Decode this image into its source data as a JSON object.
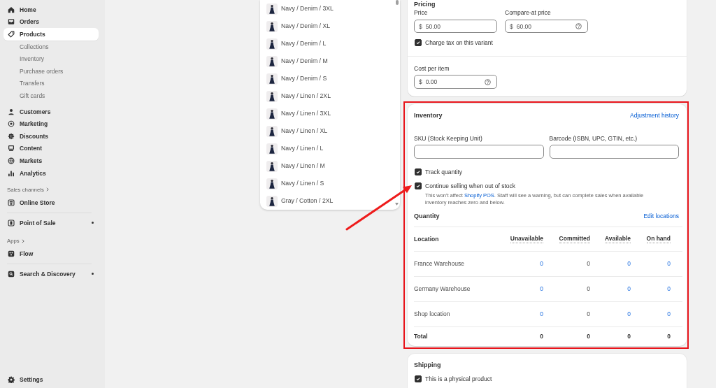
{
  "sidebar": {
    "nav": [
      {
        "items": [
          {
            "label": "Home",
            "selected": false
          },
          {
            "label": "Orders",
            "selected": false
          },
          {
            "label": "Products",
            "selected": true,
            "children": [
              {
                "label": "Collections",
                "selected": false
              },
              {
                "label": "Inventory",
                "selected": false
              },
              {
                "label": "Purchase orders",
                "selected": false
              },
              {
                "label": "Transfers",
                "selected": false
              },
              {
                "label": "Gift cards",
                "selected": false
              }
            ]
          }
        ]
      },
      {
        "items": [
          {
            "label": "Customers",
            "selected": false
          },
          {
            "label": "Marketing",
            "selected": false
          },
          {
            "label": "Discounts",
            "selected": false
          },
          {
            "label": "Content",
            "selected": false
          },
          {
            "label": "Markets",
            "selected": false
          },
          {
            "label": "Analytics",
            "selected": false
          }
        ]
      }
    ],
    "sections": [
      {
        "heading": "Sales channels",
        "items": [
          {
            "label": "Online Store",
            "selected": false,
            "dot": false
          },
          {
            "label": "Point of Sale",
            "selected": false,
            "dot": true
          }
        ]
      },
      {
        "heading": "Apps",
        "items": [
          {
            "label": "Flow",
            "selected": false,
            "dot": false
          },
          {
            "label": "Search & Discovery",
            "selected": false,
            "dot": true
          }
        ]
      }
    ],
    "settings": {
      "label": "Settings"
    }
  },
  "variants": {
    "items": [
      {
        "label": "Navy / Denim / 3XL",
        "selected": false
      },
      {
        "label": "Navy / Denim / XL",
        "selected": false
      },
      {
        "label": "Navy / Denim / L",
        "selected": false
      },
      {
        "label": "Navy / Denim / M",
        "selected": false
      },
      {
        "label": "Navy / Denim / S",
        "selected": false
      },
      {
        "label": "Navy / Linen / 2XL",
        "selected": false
      },
      {
        "label": "Navy / Linen / 3XL",
        "selected": false
      },
      {
        "label": "Navy / Linen / XL",
        "selected": false
      },
      {
        "label": "Navy / Linen / L",
        "selected": false
      },
      {
        "label": "Navy / Linen / M",
        "selected": false
      },
      {
        "label": "Navy / Linen / S",
        "selected": false
      },
      {
        "label": "Gray / Cotton / 2XL",
        "selected": false
      }
    ]
  },
  "pricing": {
    "title": "Pricing",
    "fields": [
      {
        "label": "Price",
        "prefix": "$",
        "value": "50.00",
        "help": false
      },
      {
        "label": "Compare-at price",
        "prefix": "$",
        "value": "60.00",
        "help": true
      }
    ],
    "charge_tax": {
      "label": "Charge tax on this variant",
      "checked": true
    },
    "cost": {
      "label": "Cost per item",
      "prefix": "$",
      "value": "0.00",
      "help": true
    }
  },
  "inventory": {
    "title": "Inventory",
    "link": "Adjustment history",
    "fields": [
      {
        "label": "SKU (Stock Keeping Unit)"
      },
      {
        "label": "Barcode (ISBN, UPC, GTIN, etc.)"
      }
    ],
    "options": [
      {
        "label": "Track quantity",
        "checked": true
      },
      {
        "label": "Continue selling when out of stock",
        "checked": true,
        "note": {
          "before": "This won't affect ",
          "link": "Shopify POS",
          "after": ". Staff will see a warning, but can complete sales when available inventory reaches zero and below."
        }
      }
    ],
    "quantity": {
      "title": "Quantity",
      "link": "Edit locations",
      "columns": [
        "Location",
        "Unavailable",
        "Committed",
        "Available",
        "On hand"
      ],
      "rows": [
        {
          "cells": [
            {
              "text": "France Warehouse",
              "link": false
            },
            {
              "text": "0",
              "link": true
            },
            {
              "text": "0",
              "link": false
            },
            {
              "text": "0",
              "link": true
            },
            {
              "text": "0",
              "link": true
            }
          ]
        },
        {
          "cells": [
            {
              "text": "Germany Warehouse",
              "link": false
            },
            {
              "text": "0",
              "link": true
            },
            {
              "text": "0",
              "link": false
            },
            {
              "text": "0",
              "link": true
            },
            {
              "text": "0",
              "link": true
            }
          ]
        },
        {
          "cells": [
            {
              "text": "Shop location",
              "link": false
            },
            {
              "text": "0",
              "link": true
            },
            {
              "text": "0",
              "link": false
            },
            {
              "text": "0",
              "link": true
            },
            {
              "text": "0",
              "link": true
            }
          ]
        }
      ],
      "total": {
        "cells": [
          "Total",
          "0",
          "0",
          "0",
          "0"
        ]
      }
    }
  },
  "shipping": {
    "title": "Shipping",
    "options": [
      {
        "label": "This is a physical product",
        "checked": true
      }
    ]
  }
}
